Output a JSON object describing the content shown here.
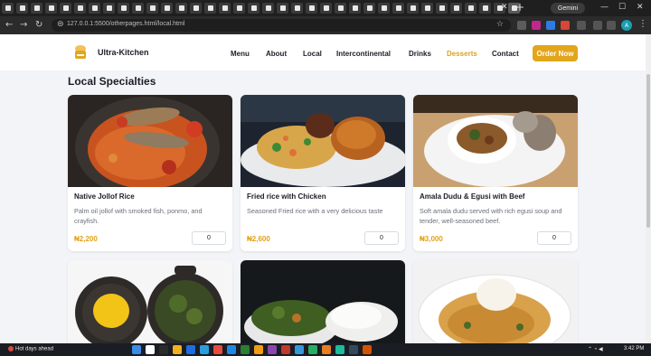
{
  "browser": {
    "tab_count": 36,
    "gemini_label": "Gemini",
    "url": "127.0.0.1:5500/otherpages.html/local.html",
    "profile_initial": "A"
  },
  "site": {
    "brand": "Ultra-Kitchen",
    "nav": [
      "Menu",
      "About",
      "Local",
      "Intercontinental",
      "Drinks",
      "Desserts",
      "Contact"
    ],
    "active_nav": "Desserts",
    "order_button": "Order Now",
    "accent_color": "#e3a51b"
  },
  "section": {
    "title": "Local Specialties"
  },
  "dishes": [
    {
      "name": "Native Jollof Rice",
      "description": "Palm oil jollof with smoked fish, ponmo, and crayfish.",
      "price": "₦2,200",
      "quantity": "0"
    },
    {
      "name": "Fried rice with Chicken",
      "description": "Seasoned Fried rice with a very delicious taste",
      "price": "₦2,600",
      "quantity": "0"
    },
    {
      "name": "Amala Dudu & Egusi with Beef",
      "description": "Soft amala dudu served with rich egusi soup and tender, well-seasoned beef.",
      "price": "₦3,000",
      "quantity": "0"
    }
  ],
  "taskbar": {
    "weather": "Hot days ahead",
    "time": "3:42 PM"
  }
}
